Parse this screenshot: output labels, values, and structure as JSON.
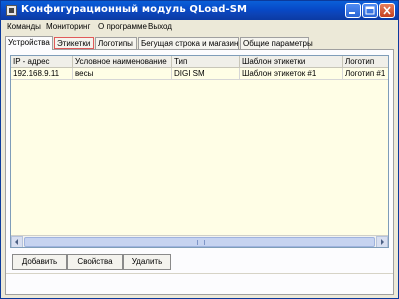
{
  "window": {
    "title": "Конфигурационный модуль QLoad-SM"
  },
  "menu": {
    "items": [
      "Команды",
      "Мониторинг",
      "О программе",
      "Выход"
    ]
  },
  "tabs": {
    "items": [
      "Устройства",
      "Этикетки",
      "Логотипы",
      "Бегущая строка и магазин",
      "Общие параметры"
    ],
    "active": "Устройства",
    "highlighted": "Этикетки"
  },
  "grid": {
    "columns": [
      "IP - адрес",
      "Условное наименование",
      "Тип",
      "Шаблон этикетки",
      "Логотип"
    ],
    "rows": [
      [
        "192.168.9.11",
        "весы",
        "DIGI SM",
        "Шаблон этикеток #1",
        "Логотип #1"
      ]
    ]
  },
  "buttons": {
    "add": "Добавить",
    "properties": "Свойства",
    "delete": "Удалить"
  },
  "colors": {
    "titlebar": "#0749c7",
    "grid_background": "#fffee6",
    "tab_highlight": "#e05a5a"
  }
}
